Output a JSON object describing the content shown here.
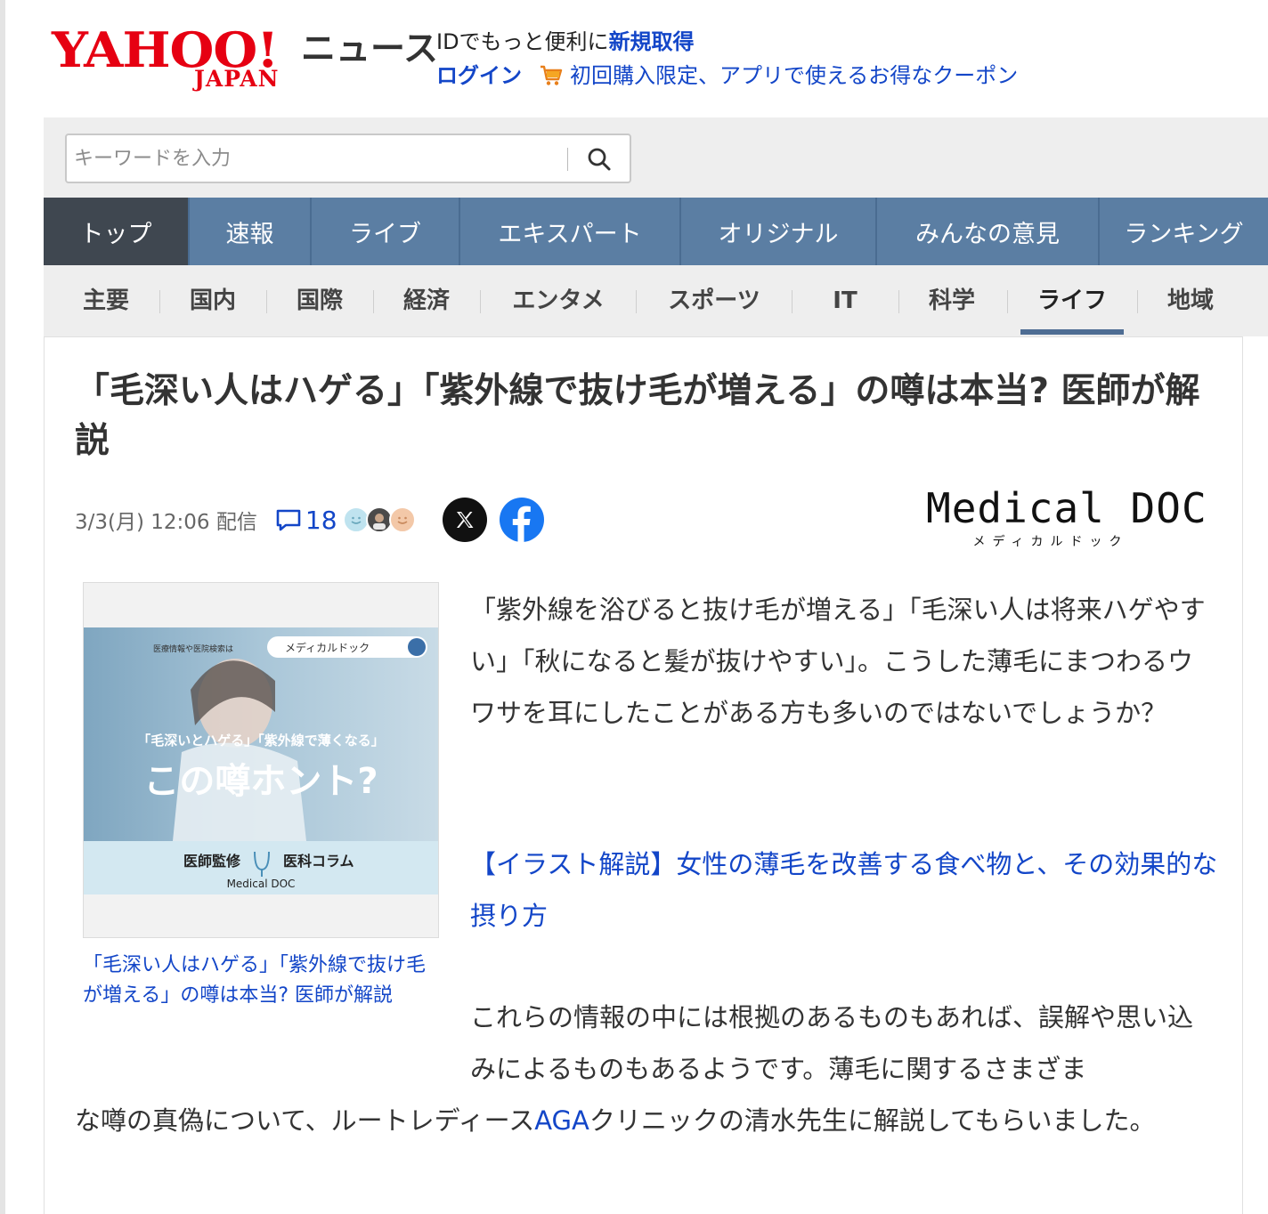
{
  "header": {
    "logo_text": "YAHOO!",
    "logo_sub": "JAPAN",
    "service_name": "ニュース",
    "promo_text": "IDでもっと便利に",
    "signup_link": "新規取得",
    "login_link": "ログイン",
    "coupon_link": "初回購入限定、アプリで使えるお得なクーポン"
  },
  "search": {
    "placeholder": "キーワードを入力"
  },
  "main_nav": [
    {
      "label": "トップ",
      "active": true
    },
    {
      "label": "速報"
    },
    {
      "label": "ライブ"
    },
    {
      "label": "エキスパート"
    },
    {
      "label": "オリジナル"
    },
    {
      "label": "みんなの意見"
    },
    {
      "label": "ランキング"
    }
  ],
  "sub_nav": [
    {
      "label": "主要"
    },
    {
      "label": "国内"
    },
    {
      "label": "国際"
    },
    {
      "label": "経済"
    },
    {
      "label": "エンタメ"
    },
    {
      "label": "スポーツ"
    },
    {
      "label": "IT"
    },
    {
      "label": "科学"
    },
    {
      "label": "ライフ",
      "active": true
    },
    {
      "label": "地域"
    }
  ],
  "article": {
    "title": "「毛深い人はハゲる」「紫外線で抜け毛が増える」の噂は本当? 医師が解説",
    "date": "3/3(月) 12:06 配信",
    "comment_count": "18",
    "source_logo": "Medical DOC",
    "source_logo_sub": "メディカルドック",
    "figure": {
      "banner_label": "医療情報や医院検索は",
      "banner_search": "メディカルドック",
      "headline_small": "「毛深いとハゲる」「紫外線で薄くなる」",
      "headline_big": "この噂ホント?",
      "footer_left": "医師監修",
      "footer_right": "医科コラム",
      "footer_brand": "Medical DOC"
    },
    "caption": "「毛深い人はハゲる」「紫外線で抜け毛が増える」の噂は本当? 医師が解説",
    "para1": "「紫外線を浴びると抜け毛が増える」「毛深い人は将来ハゲやすい」「秋になると髪が抜けやすい」。こうした薄毛にまつわるウワサを耳にしたことがある方も多いのではないでしょうか？",
    "related_link": "【イラスト解説】女性の薄毛を改善する食べ物と、その効果的な摂り方",
    "para2_part1": "これらの情報の中には根拠のあるものもあれば、誤解や思い込みによるものもあるようです。薄毛に関するさまざま",
    "para2_part2_pre": "な噂の真偽について、ルートレディース",
    "para2_link": "AGA",
    "para2_part2_post": "クリニックの清水先生に解説してもらいました。"
  },
  "colors": {
    "yahoo_red": "#e60012",
    "link_blue": "#1346c8",
    "nav_blue": "#5b7ea3",
    "nav_active": "#3f4750"
  }
}
